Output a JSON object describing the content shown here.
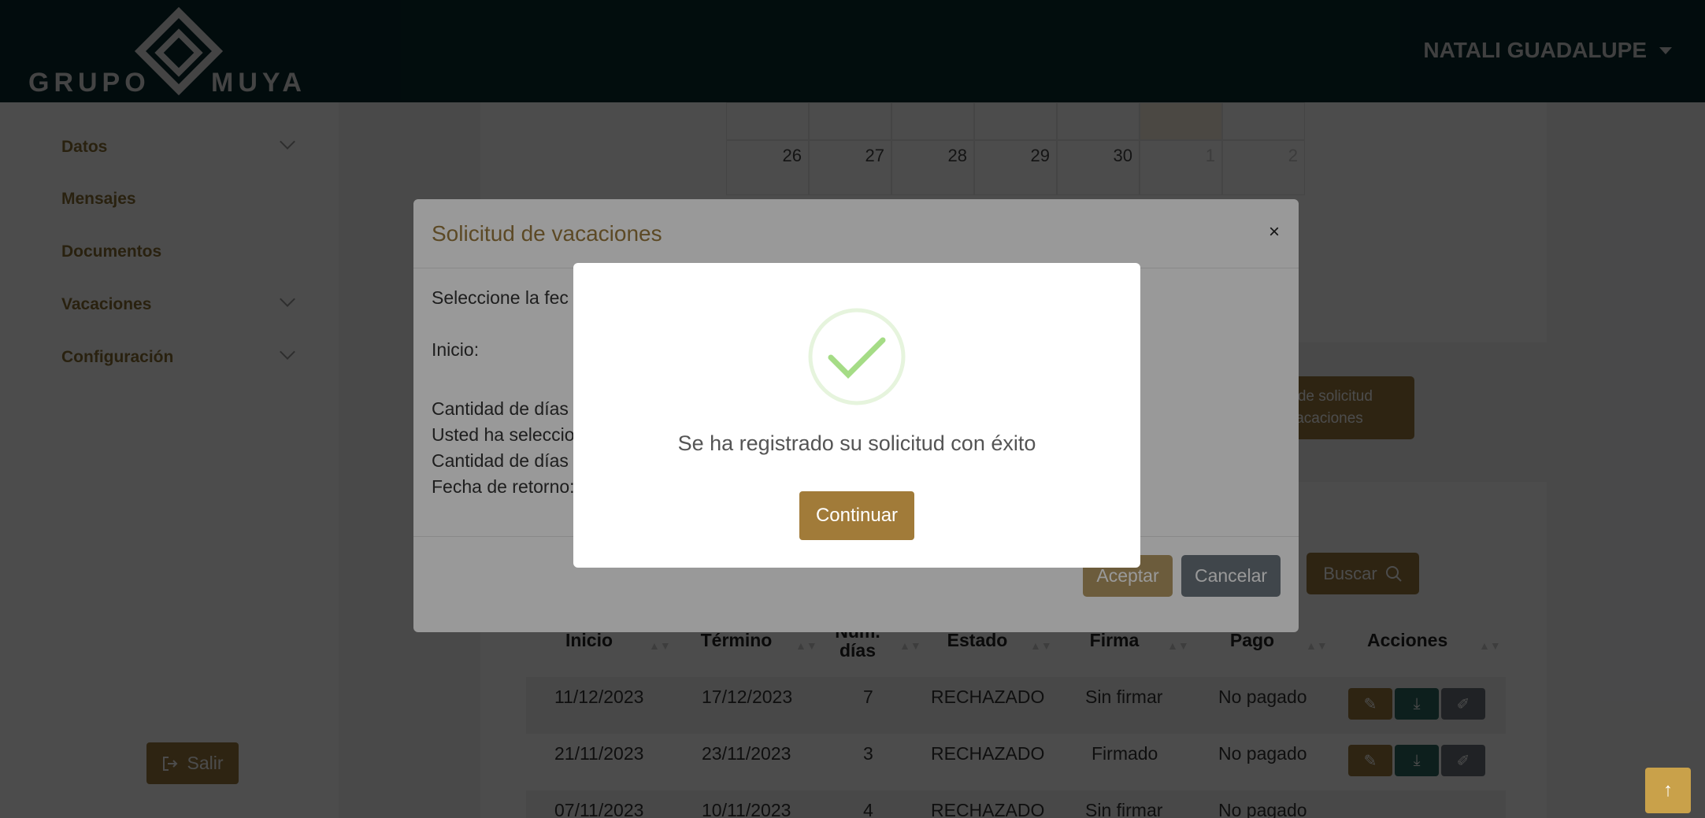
{
  "header": {
    "logo_left": "GRUPO",
    "logo_right": "MUYA",
    "user_name": "NATALI GUADALUPE"
  },
  "sidebar": {
    "items": [
      {
        "label": "Datos",
        "has_submenu": true
      },
      {
        "label": "Mensajes",
        "has_submenu": false
      },
      {
        "label": "Documentos",
        "has_submenu": false
      },
      {
        "label": "Vacaciones",
        "has_submenu": true
      },
      {
        "label": "Configuración",
        "has_submenu": true
      }
    ],
    "logout_label": "Salir"
  },
  "calendar": {
    "days": [
      "26",
      "27",
      "28",
      "29",
      "30",
      "1",
      "2"
    ]
  },
  "request_button": {
    "line1": "s de solicitud",
    "line2": "acaciones"
  },
  "search_button": "Buscar",
  "table": {
    "headers": [
      "Inicio",
      "Término",
      "Num. días",
      "Estado",
      "Firma",
      "Pago",
      "Acciones"
    ],
    "rows": [
      {
        "inicio": "11/12/2023",
        "termino": "17/12/2023",
        "dias": "7",
        "estado": "RECHAZADO",
        "firma": "Sin firmar",
        "pago": "No pagado"
      },
      {
        "inicio": "21/11/2023",
        "termino": "23/11/2023",
        "dias": "3",
        "estado": "RECHAZADO",
        "firma": "Firmado",
        "pago": "No pagado"
      },
      {
        "inicio": "07/11/2023",
        "termino": "10/11/2023",
        "dias": "4",
        "estado": "RECHAZADO",
        "firma": "Sin firmar",
        "pago": "No pagado"
      }
    ]
  },
  "vacation_modal": {
    "title": "Solicitud de vacaciones",
    "close": "×",
    "select_text": "Seleccione la fec",
    "start_label": "Inicio:",
    "line_available": "Cantidad de días a",
    "line_selected": "Usted ha seleccio",
    "line_remaining": "Cantidad de días s",
    "line_return": "Fecha de retorno:",
    "accept_label": "Aceptar",
    "cancel_label": "Cancelar"
  },
  "success_dialog": {
    "message": "Se ha registrado su solicitud con éxito",
    "button_label": "Continuar"
  },
  "colors": {
    "header_bg": "#082a2c",
    "brand_gold": "#9a7b3f",
    "success_green": "#a5dc86"
  }
}
